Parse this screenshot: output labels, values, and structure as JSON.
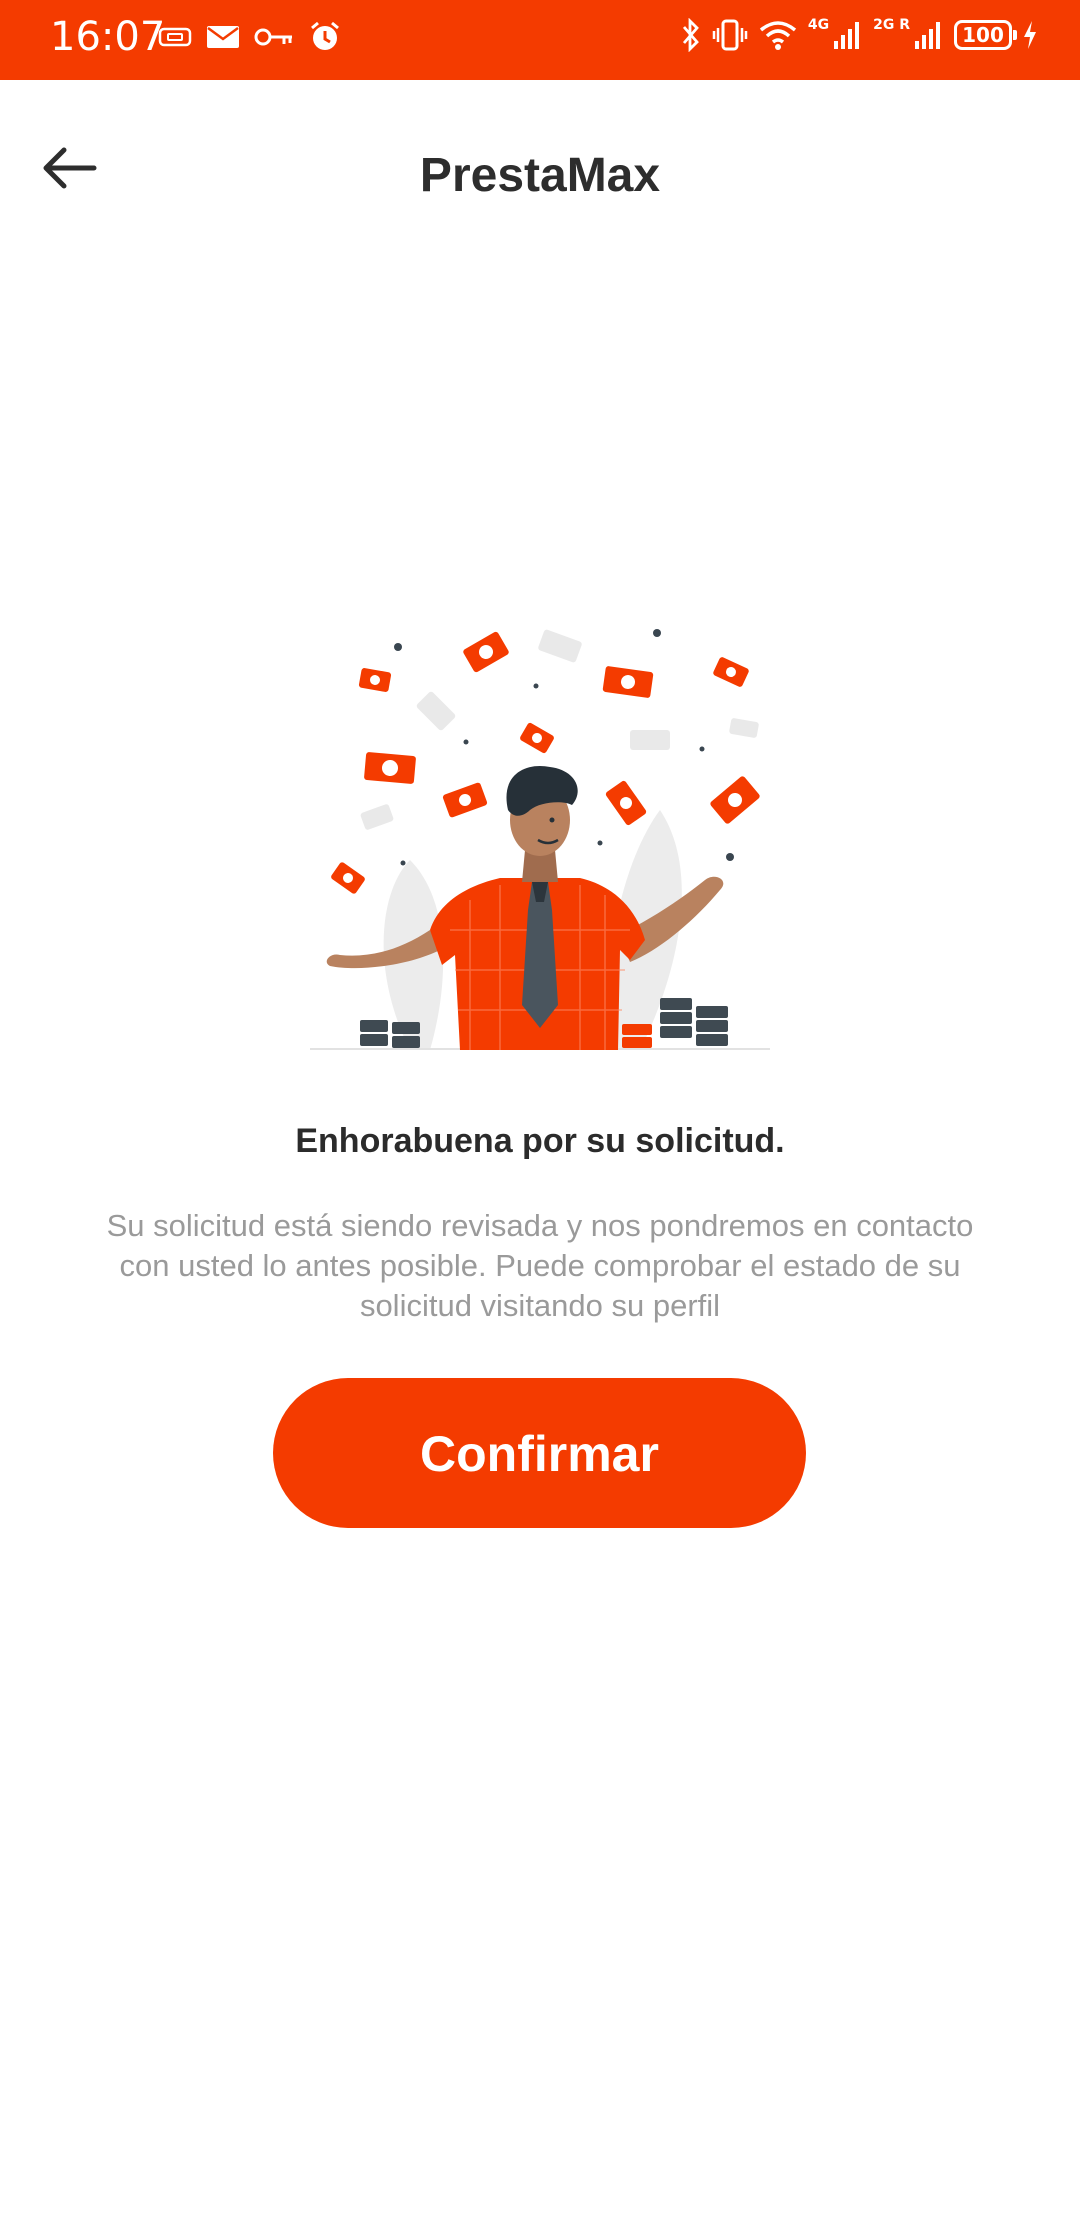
{
  "status_bar": {
    "time": "16:07",
    "network_1": "4G",
    "network_2": "2G R",
    "battery": "100"
  },
  "header": {
    "title": "PrestaMax",
    "back_icon": "arrow-left-icon"
  },
  "content": {
    "headline": "Enhorabuena por su solicitud.",
    "message": "Su solicitud está siendo revisada y nos pondremos en contacto con usted lo antes posible. Puede comprobar el estado de su solicitud visitando su perfil",
    "illustration": "man-celebrating-money-rain-illustration"
  },
  "actions": {
    "confirm_label": "Confirmar"
  },
  "colors": {
    "brand": "#f43b00",
    "text_dark": "#2b2b2b",
    "text_muted": "#9a9a9a"
  }
}
